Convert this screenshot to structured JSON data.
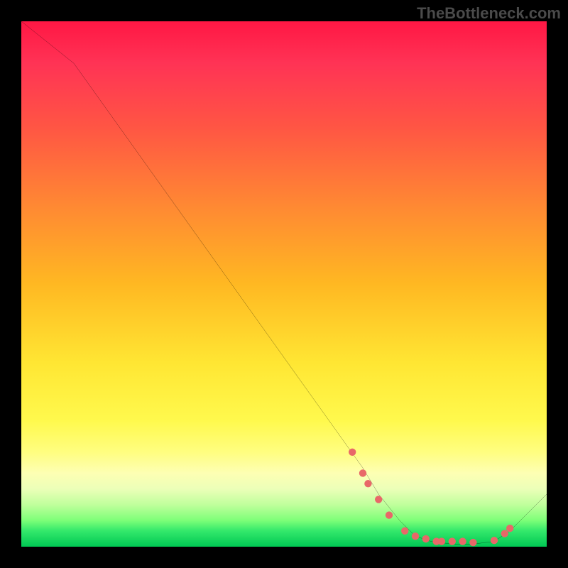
{
  "watermark": "TheBottleneck.com",
  "chart_data": {
    "type": "line",
    "title": "",
    "xlabel": "",
    "ylabel": "",
    "xlim": [
      0,
      100
    ],
    "ylim": [
      0,
      100
    ],
    "grid": false,
    "series": [
      {
        "name": "bottleneck-curve",
        "color": "#000000",
        "x": [
          0,
          5,
          10,
          15,
          20,
          25,
          30,
          35,
          40,
          45,
          50,
          55,
          60,
          65,
          68,
          72,
          75,
          78,
          82,
          86,
          90,
          93,
          96,
          100
        ],
        "y": [
          100,
          96,
          92,
          85,
          78,
          71,
          64,
          57,
          50,
          43,
          36,
          29,
          22,
          15,
          10,
          5,
          2,
          1,
          0.5,
          0.5,
          1,
          3,
          6,
          10
        ]
      }
    ],
    "markers": {
      "name": "highlight-points",
      "color": "#e86868",
      "x": [
        63,
        65,
        66,
        68,
        70,
        73,
        75,
        77,
        79,
        80,
        82,
        84,
        86,
        90,
        92,
        93
      ],
      "y": [
        18,
        14,
        12,
        9,
        6,
        3,
        2,
        1.5,
        1,
        1,
        1,
        1,
        0.8,
        1.2,
        2.5,
        3.5
      ]
    },
    "background_gradient": {
      "top": "#ff1744",
      "mid": "#ffe633",
      "bottom": "#00c853"
    }
  }
}
